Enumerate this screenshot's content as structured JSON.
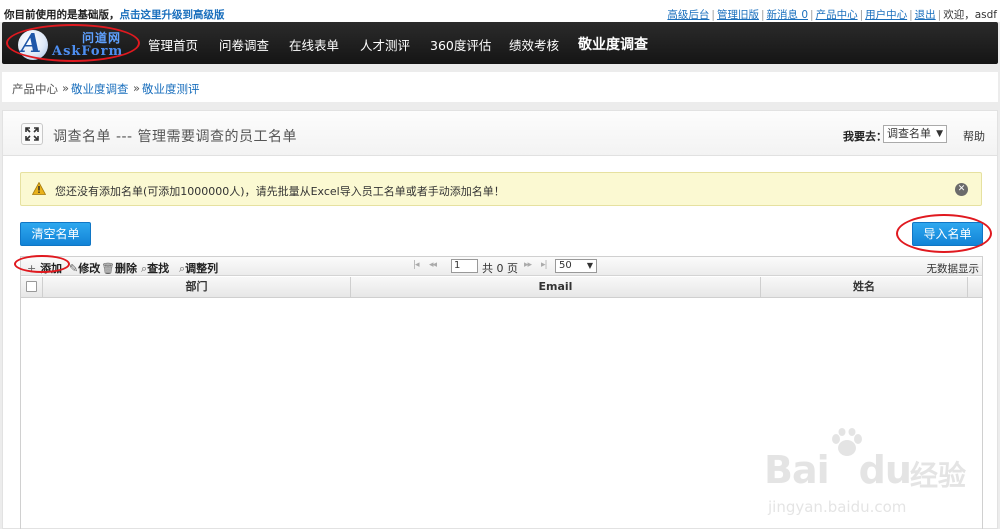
{
  "topbar": {
    "notice_prefix": "你目前使用的是基础版，",
    "notice_link": "点击这里升级到高级版",
    "links": [
      "高级后台",
      "管理旧版",
      "新消息 0",
      "产品中心",
      "用户中心",
      "退出"
    ],
    "welcome": "欢迎，asdf"
  },
  "logo": {
    "cn": "问道网",
    "en": "AskForm",
    "letter": "A"
  },
  "nav": {
    "items": [
      "管理首页",
      "问卷调查",
      "在线表单",
      "人才测评",
      "360度评估",
      "绩效考核",
      "敬业度调查"
    ],
    "active": "敬业度调查"
  },
  "breadcrumb": {
    "root": "产品中心",
    "sep": "»",
    "level1": "敬业度调查",
    "level2": "敬业度测评"
  },
  "panel": {
    "title": "调查名单 --- 管理需要调查的员工名单",
    "goto_label": "我要去：",
    "goto_select": "调查名单",
    "help": "帮助"
  },
  "alert": {
    "message": "您还没有添加名单(可添加1000000人)，请先批量从Excel导入员工名单或者手动添加名单！"
  },
  "buttons": {
    "clear": "清空名单",
    "import": "导入名单"
  },
  "grid": {
    "toolbar": {
      "add": "添加",
      "edit": "修改",
      "delete": "删除",
      "find": "查找",
      "columns": "调整列",
      "page": "1",
      "page_total": "共 0 页",
      "page_size": "50",
      "no_data": "无数据显示"
    },
    "columns": [
      "部门",
      "Email",
      "姓名"
    ]
  },
  "watermark": {
    "brand": "Bai",
    "brand2": "du",
    "cn": "经验",
    "url": "jingyan.baidu.com"
  },
  "colors": {
    "accent": "#1a6fbd",
    "nav_bg": "#1c1c1c",
    "button_blue": "#1a8ee0",
    "highlight_ring": "#e0191f"
  }
}
